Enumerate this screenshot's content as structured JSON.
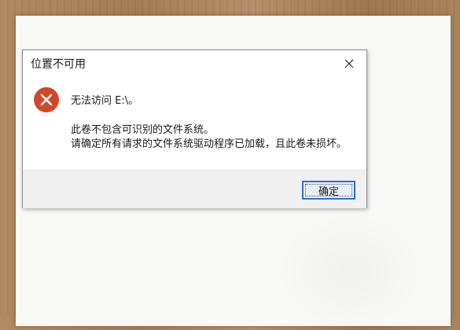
{
  "dialog": {
    "title": "位置不可用",
    "icon": "error-icon",
    "icon_color": "#d24726",
    "message": "无法访问 E:\\。",
    "detail_lines": [
      "此卷不包含可识别的文件系统。",
      "请确定所有请求的文件系统驱动程序已加载，且此卷未损坏。"
    ],
    "buttons": {
      "ok_label": "确定"
    },
    "accent_color": "#2f6fcf"
  }
}
